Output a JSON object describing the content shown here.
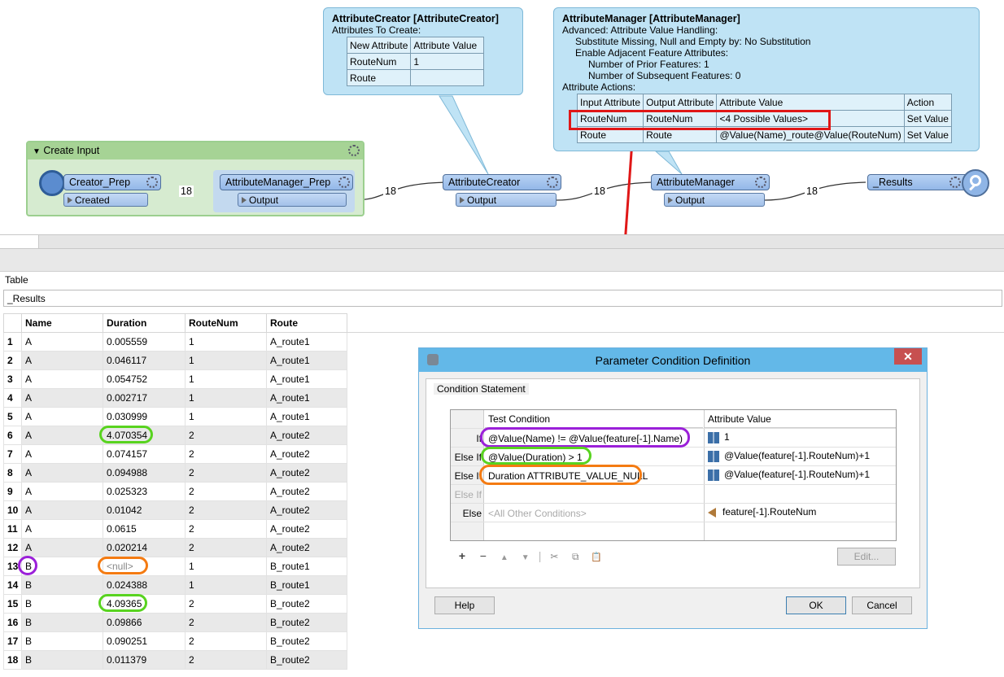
{
  "attribute_creator": {
    "title": "AttributeCreator [AttributeCreator]",
    "subtitle": "Attributes To Create:",
    "headers": [
      "New Attribute",
      "Attribute Value"
    ],
    "rows": [
      [
        "RouteNum",
        "1"
      ],
      [
        "Route",
        ""
      ]
    ]
  },
  "attribute_manager": {
    "title": "AttributeManager [AttributeManager]",
    "lines": [
      "Advanced: Attribute Value Handling:",
      "Substitute Missing, Null and Empty by: No Substitution",
      "Enable Adjacent Feature Attributes:",
      "Number of Prior Features: 1",
      "Number of Subsequent Features: 0",
      "Attribute Actions:"
    ],
    "headers": [
      "Input Attribute",
      "Output Attribute",
      "Attribute Value",
      "Action"
    ],
    "rows": [
      [
        "RouteNum",
        "RouteNum",
        "<4 Possible Values>",
        "Set Value"
      ],
      [
        "Route",
        "Route",
        "@Value(Name)_route@Value(RouteNum)",
        "Set Value"
      ]
    ]
  },
  "workflow": {
    "bookmark_title": "Create Input",
    "creator": "Creator_Prep",
    "creator_port": "Created",
    "am_prep": "AttributeManager_Prep",
    "am_prep_port": "Output",
    "attr_creator": "AttributeCreator",
    "attr_creator_port": "Output",
    "attr_manager": "AttributeManager",
    "attr_manager_port": "Output",
    "results": "_Results",
    "counts": [
      "18",
      "18",
      "18",
      "18"
    ]
  },
  "panel": {
    "label": "Table",
    "results_name": "_Results"
  },
  "table": {
    "headers": [
      "Name",
      "Duration",
      "RouteNum",
      "Route"
    ],
    "rows": [
      [
        "1",
        "A",
        "0.005559",
        "1",
        "A_route1"
      ],
      [
        "2",
        "A",
        "0.046117",
        "1",
        "A_route1"
      ],
      [
        "3",
        "A",
        "0.054752",
        "1",
        "A_route1"
      ],
      [
        "4",
        "A",
        "0.002717",
        "1",
        "A_route1"
      ],
      [
        "5",
        "A",
        "0.030999",
        "1",
        "A_route1"
      ],
      [
        "6",
        "A",
        "4.070354",
        "2",
        "A_route2"
      ],
      [
        "7",
        "A",
        "0.074157",
        "2",
        "A_route2"
      ],
      [
        "8",
        "A",
        "0.094988",
        "2",
        "A_route2"
      ],
      [
        "9",
        "A",
        "0.025323",
        "2",
        "A_route2"
      ],
      [
        "10",
        "A",
        "0.01042",
        "2",
        "A_route2"
      ],
      [
        "11",
        "A",
        "0.0615",
        "2",
        "A_route2"
      ],
      [
        "12",
        "A",
        "0.020214",
        "2",
        "A_route2"
      ],
      [
        "13",
        "B",
        "<null>",
        "1",
        "B_route1"
      ],
      [
        "14",
        "B",
        "0.024388",
        "1",
        "B_route1"
      ],
      [
        "15",
        "B",
        "4.09365",
        "2",
        "B_route2"
      ],
      [
        "16",
        "B",
        "0.09866",
        "2",
        "B_route2"
      ],
      [
        "17",
        "B",
        "0.090251",
        "2",
        "B_route2"
      ],
      [
        "18",
        "B",
        "0.011379",
        "2",
        "B_route2"
      ]
    ]
  },
  "dialog": {
    "title": "Parameter Condition Definition",
    "close": "✕",
    "group_label": "Condition Statement",
    "col_test": "Test Condition",
    "col_value": "Attribute Value",
    "rows": [
      {
        "label": "If",
        "test": "@Value(Name) != @Value(feature[-1].Name)",
        "value": "1"
      },
      {
        "label": "Else If",
        "test": "@Value(Duration) > 1",
        "value": "@Value(feature[-1].RouteNum)+1"
      },
      {
        "label": "Else If",
        "test": "Duration ATTRIBUTE_VALUE_NULL",
        "value": "@Value(feature[-1].RouteNum)+1"
      },
      {
        "label": "Else If",
        "test": "",
        "value": ""
      },
      {
        "label": "Else",
        "test": "<All Other Conditions>",
        "value": "feature[-1].RouteNum"
      }
    ],
    "toolbar": [
      "+",
      "−",
      "▲",
      "▼",
      "✂",
      "⧉",
      "📋"
    ],
    "edit_button": "Edit...",
    "help_button": "Help",
    "ok_button": "OK",
    "cancel_button": "Cancel"
  },
  "colors": {
    "highlight_green": "#58d31f",
    "highlight_orange": "#f47b12",
    "highlight_purple": "#9b20d9",
    "highlight_red": "#e01717",
    "callout_bg": "#bfe3f5",
    "bookmark_bg": "#d6ebd0"
  }
}
